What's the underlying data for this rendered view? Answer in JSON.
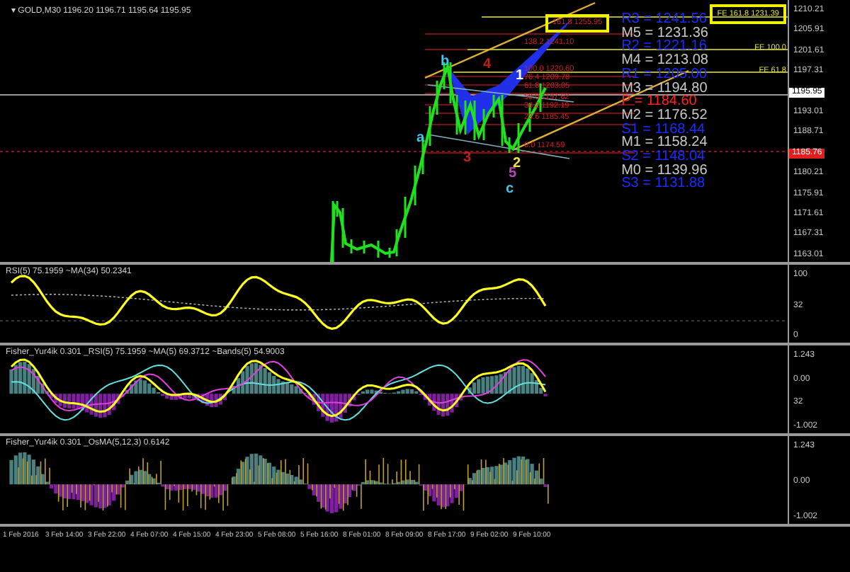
{
  "window": {
    "menu_glyph": "▾",
    "title": "GOLD,M30  1196.20 1196.71 1195.64 1195.95"
  },
  "main_panel": {
    "price_axis": [
      {
        "text": "1210.21",
        "kind": "tick"
      },
      {
        "text": "1205.91",
        "kind": "tick"
      },
      {
        "text": "1201.61",
        "kind": "tick"
      },
      {
        "text": "1197.31",
        "kind": "tick"
      },
      {
        "text": "1195.95",
        "kind": "current"
      },
      {
        "text": "1193.01",
        "kind": "tick"
      },
      {
        "text": "1188.71",
        "kind": "tick"
      },
      {
        "text": "1185.76",
        "kind": "marker"
      },
      {
        "text": "1180.21",
        "kind": "tick"
      },
      {
        "text": "1175.91",
        "kind": "tick"
      },
      {
        "text": "1171.61",
        "kind": "tick"
      },
      {
        "text": "1167.31",
        "kind": "tick"
      },
      {
        "text": "1163.01",
        "kind": "tick"
      }
    ],
    "pivot_levels": [
      {
        "label": "R3 = 1241.56",
        "kind": "resistance"
      },
      {
        "label": "M5 = 1231.36",
        "kind": "mid"
      },
      {
        "label": "R2 = 1221.16",
        "kind": "resistance"
      },
      {
        "label": "M4 = 1213.08",
        "kind": "mid"
      },
      {
        "label": "R1 = 1205.00",
        "kind": "resistance"
      },
      {
        "label": "M3 = 1194.80",
        "kind": "mid"
      },
      {
        "label": "P  = 1184.60",
        "kind": "pivot"
      },
      {
        "label": "M2 = 1176.52",
        "kind": "mid"
      },
      {
        "label": "S1 = 1168.44",
        "kind": "resistance"
      },
      {
        "label": "M1 = 1158.24",
        "kind": "mid"
      },
      {
        "label": "S2 = 1148.04",
        "kind": "resistance"
      },
      {
        "label": "M0 = 1139.96",
        "kind": "mid"
      },
      {
        "label": "S3 = 1131.88",
        "kind": "resistance"
      }
    ],
    "expansion_labels": [
      "FE 161.8 1231.39",
      "FE 100.0",
      "FE 61.8"
    ],
    "fibo_labels": [
      "161.8 1255.95",
      "138.2 1241.10",
      "100.0 1220.60",
      "76.4 1209.78",
      "61.8 1203.05",
      "50.0 1197.62",
      "38.2 1192.19",
      "23.6 1185.45",
      "0.0 1174.59"
    ],
    "wave_labels": [
      {
        "text": "a",
        "color": "#3cc8f0"
      },
      {
        "text": "b",
        "color": "#3cc8f0"
      },
      {
        "text": "c",
        "color": "#3cc8f0"
      },
      {
        "text": "1",
        "color": "#ffffff"
      },
      {
        "text": "2",
        "color": "#f0e040"
      },
      {
        "text": "3",
        "color": "#c02020"
      },
      {
        "text": "4",
        "color": "#c02020"
      },
      {
        "text": "5",
        "color": "#c040c0"
      }
    ]
  },
  "rsi_panel": {
    "title": "RSI(5) 75.1959  ~MA(34) 50.2341",
    "axis": [
      "100",
      "32",
      "0"
    ]
  },
  "fisher_panel": {
    "title": "Fisher_Yur4ik 0.301 _RSI(5) 75.1959  ~MA(5) 69.3712  ~Bands(5) 54.9003",
    "axis": [
      "1.243",
      "0.00",
      "32",
      "-1.002"
    ]
  },
  "osma_panel": {
    "title": "Fisher_Yur4ik 0.301 _OsMA(5,12,3) 0.6142",
    "axis": [
      "1.243",
      "0.00",
      "-1.002"
    ]
  },
  "time_axis": [
    "1 Feb 2016",
    "3 Feb 14:00",
    "3 Feb 22:00",
    "4 Feb 07:00",
    "4 Feb 15:00",
    "4 Feb 23:00",
    "5 Feb 08:00",
    "5 Feb 16:00",
    "8 Feb 01:00",
    "8 Feb 09:00",
    "8 Feb 17:00",
    "9 Feb 02:00",
    "9 Feb 10:00"
  ]
}
